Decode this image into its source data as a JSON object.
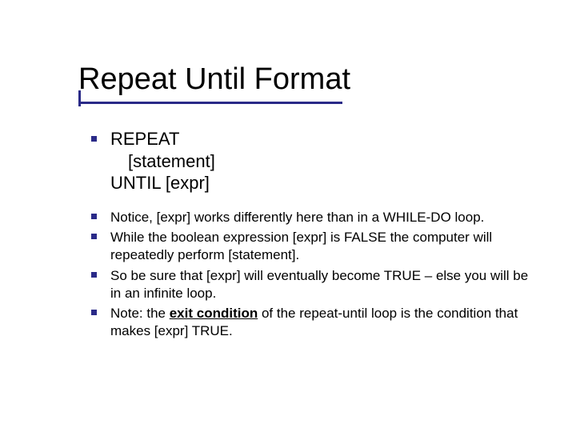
{
  "title": "Repeat Until Format",
  "syntax": {
    "line1": "REPEAT",
    "line2": "[statement]",
    "line3": "UNTIL [expr]"
  },
  "points": [
    "Notice, [expr] works differently here than in a WHILE-DO loop.",
    "While the boolean expression [expr] is FALSE the computer will repeatedly perform [statement].",
    "So be sure that [expr] will eventually become TRUE – else you will be in an infinite loop."
  ],
  "note": {
    "prefix": "Note: the ",
    "bold": "exit condition",
    "suffix": " of the repeat-until loop is the condition that makes [expr] TRUE."
  }
}
